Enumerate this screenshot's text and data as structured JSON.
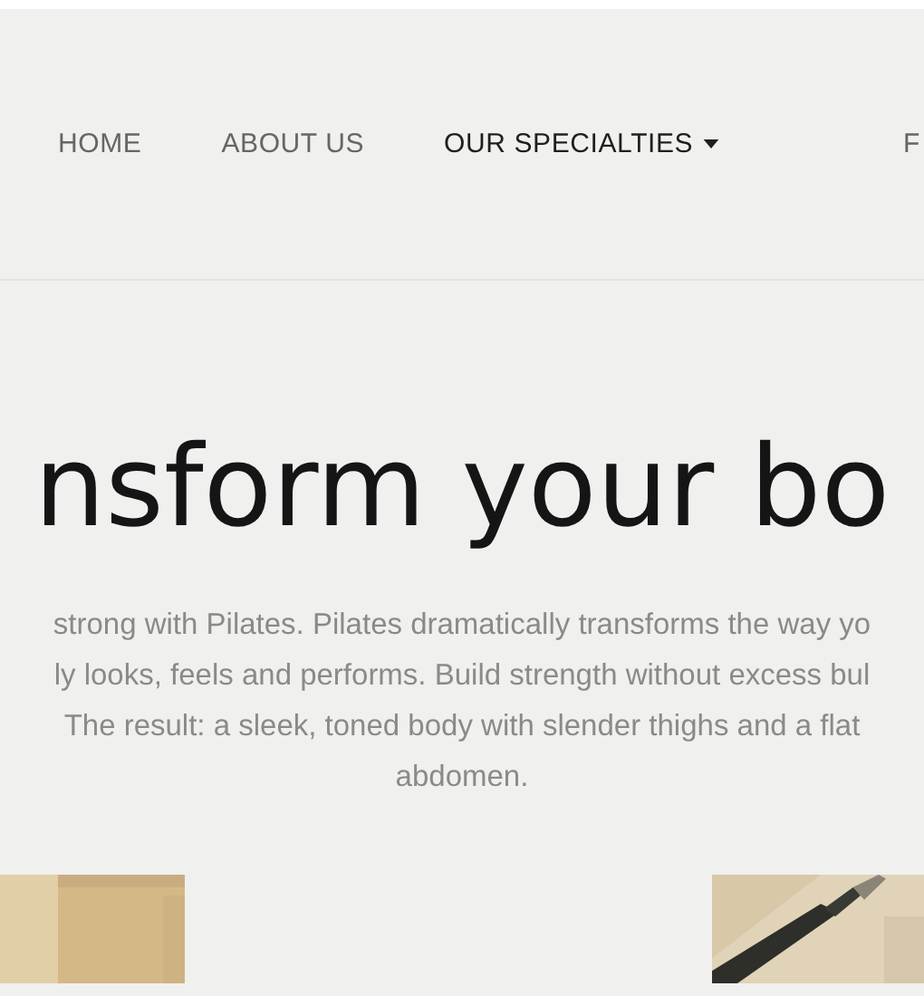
{
  "nav": {
    "items": [
      {
        "label": "HOME",
        "selected": false,
        "has_dropdown": false
      },
      {
        "label": "ABOUT US",
        "selected": false,
        "has_dropdown": false
      },
      {
        "label": "OUR SPECIALTIES",
        "selected": true,
        "has_dropdown": true
      },
      {
        "label": "F",
        "selected": false,
        "has_dropdown": false
      }
    ]
  },
  "hero": {
    "heading": "nsform your bo",
    "description_lines": [
      " strong with Pilates. Pilates dramatically transforms the way yo",
      "ly looks, feels and performs. Build strength without excess bul",
      "The result: a sleek, toned body with slender thighs and a flat",
      "abdomen."
    ]
  }
}
